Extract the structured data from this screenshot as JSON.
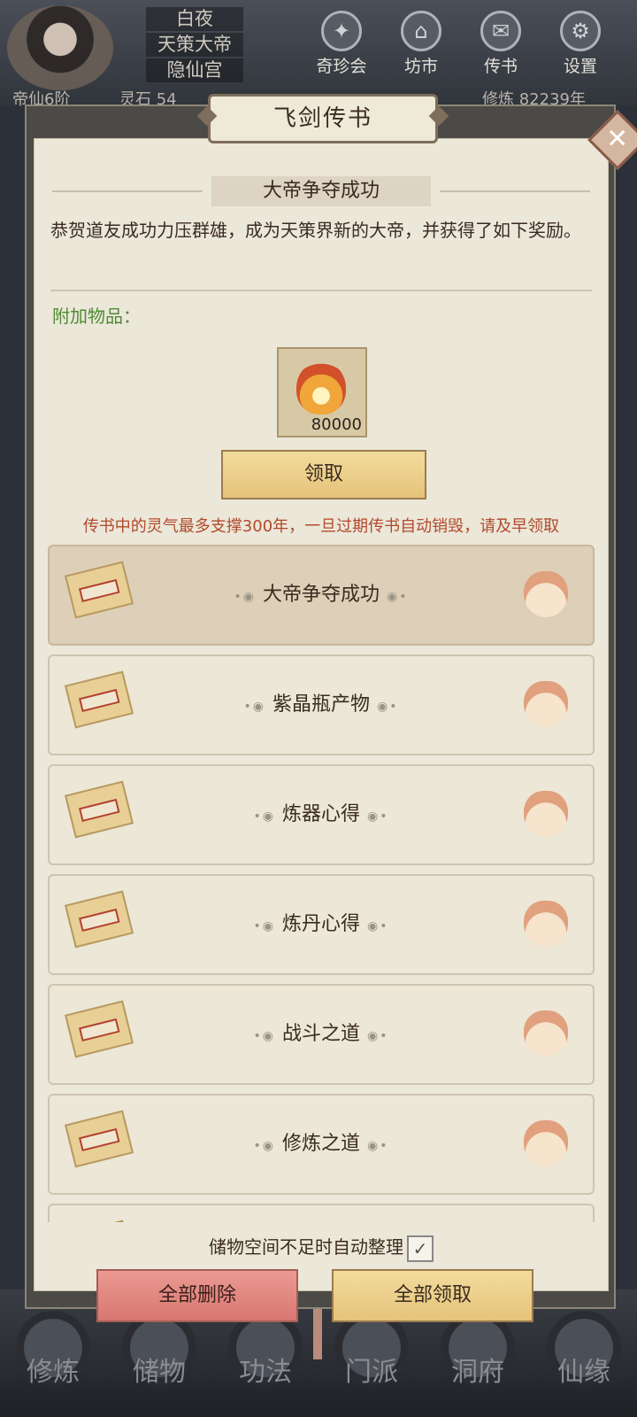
{
  "hud": {
    "player_lines": [
      "白夜",
      "天策大帝",
      "隐仙宫"
    ],
    "stat_left": "帝仙6阶",
    "stat_mid": "灵石 54",
    "stat_right": "修炼 82239年",
    "top_nav": [
      {
        "label": "奇珍会",
        "icon": "treasure-icon"
      },
      {
        "label": "坊市",
        "icon": "market-icon"
      },
      {
        "label": "传书",
        "icon": "letter-icon"
      },
      {
        "label": "设置",
        "icon": "gear-icon"
      }
    ],
    "bottom_nav": [
      "修炼",
      "储物",
      "功法",
      "门派",
      "洞府",
      "仙缘"
    ]
  },
  "dialog": {
    "title": "飞剑传书",
    "close_icon": "close-icon",
    "message": {
      "subject": "大帝争夺成功",
      "body": "恭贺道友成功力压群雄，成为天策界新的大帝，并获得了如下奖励。",
      "attachments_label": "附加物品：",
      "item": {
        "icon": "flame-icon",
        "count": "80000"
      },
      "claim_label": "领取"
    },
    "warning": "传书中的灵气最多支撑300年，一旦过期传书自动销毁，请及早领取",
    "mails": [
      {
        "title": "大帝争夺成功",
        "selected": true
      },
      {
        "title": "紫晶瓶产物",
        "selected": false
      },
      {
        "title": "炼器心得",
        "selected": false
      },
      {
        "title": "炼丹心得",
        "selected": false
      },
      {
        "title": "战斗之道",
        "selected": false
      },
      {
        "title": "修炼之道",
        "selected": false
      }
    ],
    "auto_sort_label": "储物空间不足时自动整理",
    "auto_sort_checked": true,
    "delete_all_label": "全部删除",
    "claim_all_label": "全部领取"
  }
}
